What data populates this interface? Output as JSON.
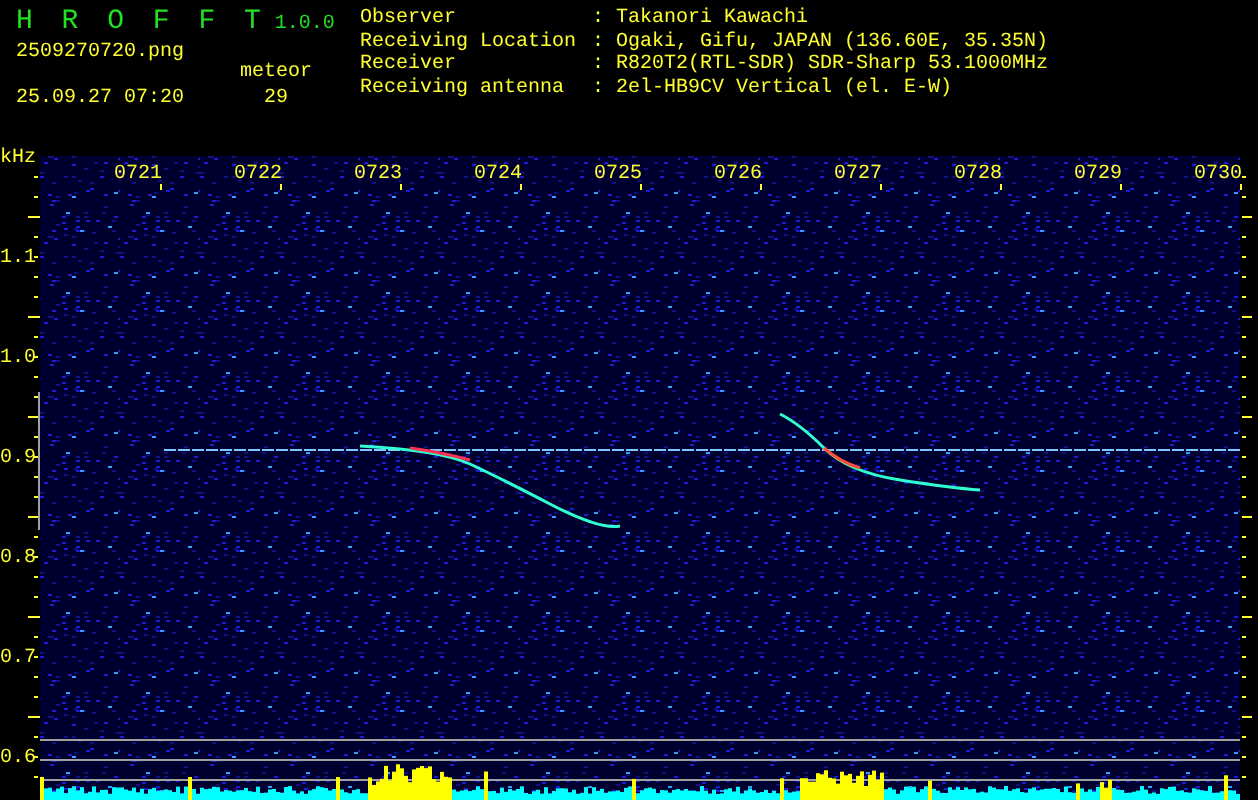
{
  "app": {
    "name": "H R O F F T",
    "version": "1.0.0"
  },
  "file": {
    "name": "2509270720.png",
    "datetime": "25.09.27 07:20"
  },
  "meteor": {
    "label": "meteor",
    "count": "29"
  },
  "station": [
    {
      "label": "Observer",
      "colon": ":",
      "value": "Takanori Kawachi"
    },
    {
      "label": "Receiving Location",
      "colon": ":",
      "value": "Ogaki, Gifu, JAPAN (136.60E, 35.35N)"
    },
    {
      "label": "Receiver",
      "colon": ":",
      "value": "R820T2(RTL-SDR) SDR-Sharp 53.1000MHz"
    },
    {
      "label": "Receiving antenna",
      "colon": ":",
      "value": "2el-HB9CV Vertical (el. E-W)"
    }
  ],
  "spectrogram": {
    "freq_unit": "kHz",
    "freq_labels": [
      "1.1",
      "1.0",
      "0.9",
      "0.8",
      "0.7",
      "0.6"
    ],
    "time_labels": [
      "0721",
      "0722",
      "0723",
      "0724",
      "0725",
      "0726",
      "0727",
      "0728",
      "0729",
      "0730"
    ]
  }
}
